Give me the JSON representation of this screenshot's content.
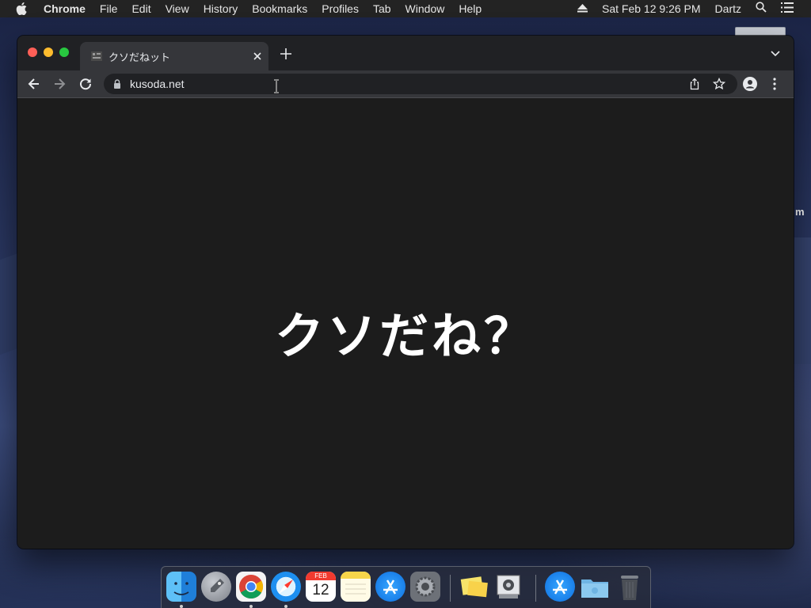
{
  "menubar": {
    "apple_icon": "apple-icon",
    "app_name": "Chrome",
    "items": [
      "File",
      "Edit",
      "View",
      "History",
      "Bookmarks",
      "Profiles",
      "Tab",
      "Window",
      "Help"
    ],
    "clock": "Sat Feb 12  9:26 PM",
    "user": "Dartz",
    "status_icons": [
      "eject-icon",
      "search-icon",
      "list-icon"
    ]
  },
  "desktop": {
    "edge_label": "m"
  },
  "browser": {
    "tab": {
      "title": "クソだねット",
      "favicon": "site-favicon"
    },
    "address": {
      "url": "kusoda.net"
    }
  },
  "page": {
    "headline": "クソだね？"
  },
  "dock": {
    "apps": [
      {
        "name": "finder",
        "running": true
      },
      {
        "name": "launchpad",
        "running": false
      },
      {
        "name": "chrome",
        "running": true
      },
      {
        "name": "safari",
        "running": true
      },
      {
        "name": "calendar",
        "running": false,
        "month": "FEB",
        "day": "12"
      },
      {
        "name": "notes",
        "running": false
      },
      {
        "name": "app-store",
        "running": false
      },
      {
        "name": "system-preferences",
        "running": false
      },
      {
        "name": "stickies",
        "running": false
      },
      {
        "name": "preview",
        "running": false
      },
      {
        "name": "app-store-downloads",
        "running": false
      },
      {
        "name": "folder",
        "running": false
      },
      {
        "name": "trash",
        "running": false
      }
    ]
  },
  "colors": {
    "menubar_bg": "#232323",
    "tabstrip_bg": "#202124",
    "toolbar_bg": "#35363a",
    "page_bg": "#1c1c1c",
    "traffic_close": "#ff5f57",
    "traffic_min": "#febc2e",
    "traffic_max": "#28c840"
  }
}
